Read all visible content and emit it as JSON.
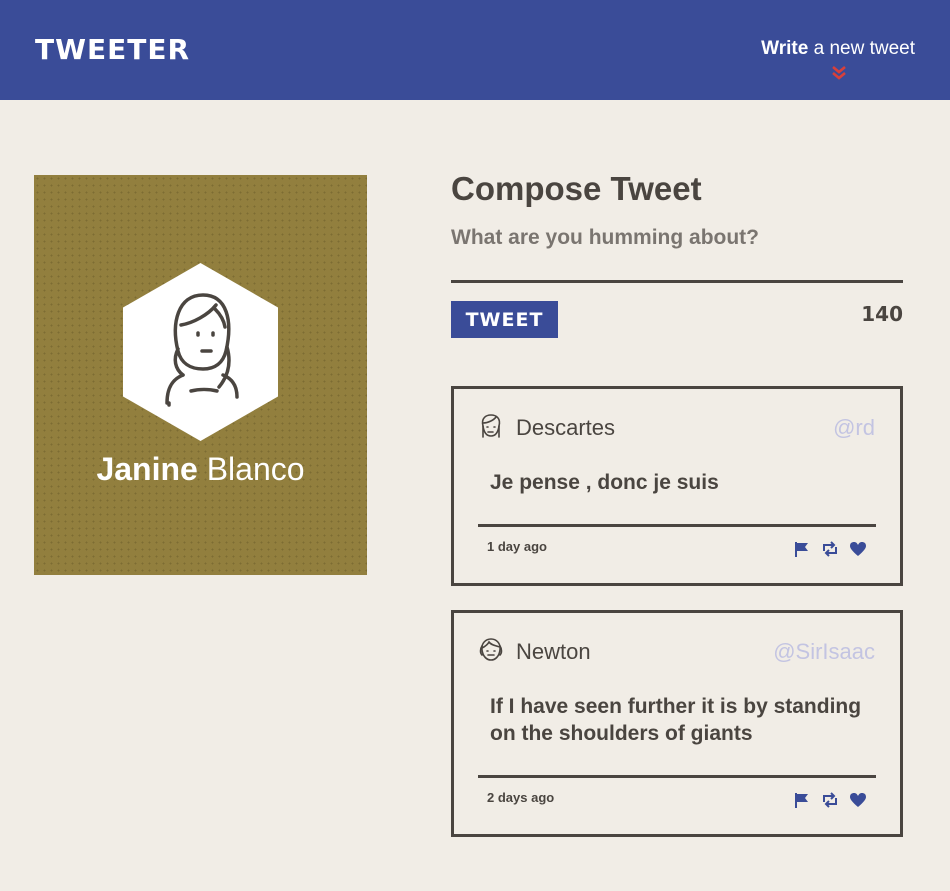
{
  "nav": {
    "brand": "TWEETER",
    "write_bold": "Write",
    "write_rest": " a new tweet",
    "icons": {
      "toggle": "double-chevron-down-icon"
    },
    "colors": {
      "bar": "#3a4c98",
      "chevron": "#d9403a"
    }
  },
  "profile": {
    "first_name": "Janine",
    "last_name": "Blanco",
    "colors": {
      "background": "#927f3e"
    }
  },
  "compose": {
    "title": "Compose Tweet",
    "placeholder": "What are you humming about?",
    "button_label": "TWEET",
    "counter": "140"
  },
  "tweets": [
    {
      "name": "Descartes",
      "handle": "@rd",
      "content": "Je pense , donc je suis",
      "date": "1 day ago",
      "icons": [
        "flag-icon",
        "retweet-icon",
        "heart-icon"
      ]
    },
    {
      "name": "Newton",
      "handle": "@SirIsaac",
      "content": "If I have seen further it is by standing on the shoulders of giants",
      "date": "2 days ago",
      "icons": [
        "flag-icon",
        "retweet-icon",
        "heart-icon"
      ]
    }
  ],
  "colors": {
    "accent": "#3a4c98",
    "text": "#4a4540",
    "handle": "#c3c4e2",
    "page": "#f1ede6"
  }
}
